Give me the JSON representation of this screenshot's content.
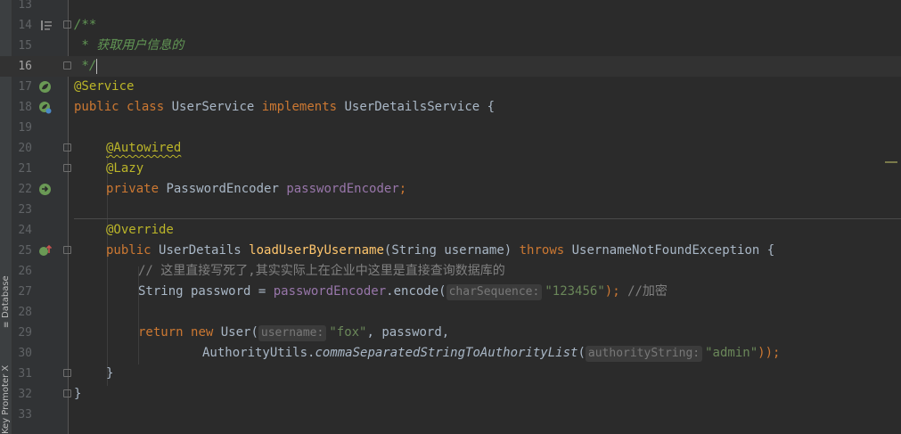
{
  "side_tabs": [
    {
      "label": "Database",
      "icon": "database-icon"
    },
    {
      "label": "Key Promoter X",
      "icon": "key-promoter-icon"
    }
  ],
  "lines": [
    {
      "num": "13",
      "text": ""
    },
    {
      "num": "14",
      "text": "/**"
    },
    {
      "num": "15",
      "text": " * 获取用户信息的"
    },
    {
      "num": "16",
      "text": " */"
    },
    {
      "num": "17",
      "text": "@Service"
    },
    {
      "num": "18",
      "text": "public class UserService implements UserDetailsService {"
    },
    {
      "num": "19",
      "text": ""
    },
    {
      "num": "20",
      "text": "    @Autowired"
    },
    {
      "num": "21",
      "text": "    @Lazy"
    },
    {
      "num": "22",
      "text": "    private PasswordEncoder passwordEncoder;"
    },
    {
      "num": "23",
      "text": ""
    },
    {
      "num": "24",
      "text": "    @Override"
    },
    {
      "num": "25",
      "text": "    public UserDetails loadUserByUsername(String username) throws UsernameNotFoundException {"
    },
    {
      "num": "26",
      "text": "        // 这里直接写死了,其实实际上在企业中这里是直接查询数据库的"
    },
    {
      "num": "27",
      "text": "        String password = passwordEncoder.encode(charSequence: \"123456\"); //加密"
    },
    {
      "num": "28",
      "text": ""
    },
    {
      "num": "29",
      "text": "        return new User(username: \"fox\", password,"
    },
    {
      "num": "30",
      "text": "                AuthorityUtils.commaSeparatedStringToAuthorityList(authorityString: \"admin\"));"
    },
    {
      "num": "31",
      "text": "    }"
    },
    {
      "num": "32",
      "text": "}"
    },
    {
      "num": "33",
      "text": ""
    }
  ],
  "tokens": {
    "l14_doc": "/**",
    "l15_doc": " * 获取用户信息的",
    "l16_doc": " */",
    "l17_ann": "@Service",
    "kw_public": "public",
    "kw_class": "class",
    "cls_userservice": "UserService",
    "kw_implements": "implements",
    "cls_uds": "UserDetailsService",
    "brace_open": " {",
    "l20_ann": "@Autowired",
    "l21_ann": "@Lazy",
    "kw_private": "private",
    "cls_pe": "PasswordEncoder",
    "fld_pe": "passwordEncoder",
    "semi": ";",
    "l24_ann": "@Override",
    "cls_ud": "UserDetails",
    "fn_load": "loadUserByUsername",
    "sig_params": "(String username) ",
    "kw_throws": "throws",
    "cls_unfe": "UsernameNotFoundException",
    "l26_cmt": "// 这里直接写死了,其实实际上在企业中这里是直接查询数据库的",
    "l27_pre": "String password = ",
    "l27_call": ".encode(",
    "hint_charseq": "charSequence:",
    "str_123456": "\"123456\"",
    "l27_close": ");",
    "l27_cmt": " //加密",
    "kw_return": "return",
    "kw_new": "new",
    "l29_user": " User(",
    "hint_username": "username:",
    "str_fox": "\"fox\"",
    "l29_rest": ", password,",
    "l30_cls": "AuthorityUtils.",
    "l30_fn": "commaSeparatedStringToAuthorityList",
    "l30_paren": "(",
    "hint_authority": "authorityString:",
    "str_admin": "\"admin\"",
    "l30_close": "));",
    "l31_brace": "}",
    "l32_brace": "}"
  },
  "gutter_icons": {
    "17": "spring-bean-icon",
    "18": "spring-bean-icon",
    "22": "autowired-bean-icon",
    "25": "override-method-icon"
  },
  "colors": {
    "background": "#2b2b2b",
    "keyword": "#cc7832",
    "annotation": "#bbb529",
    "field": "#9876aa",
    "method": "#ffc66d",
    "string": "#6a8759",
    "comment": "#808080",
    "doc_comment": "#629755"
  }
}
